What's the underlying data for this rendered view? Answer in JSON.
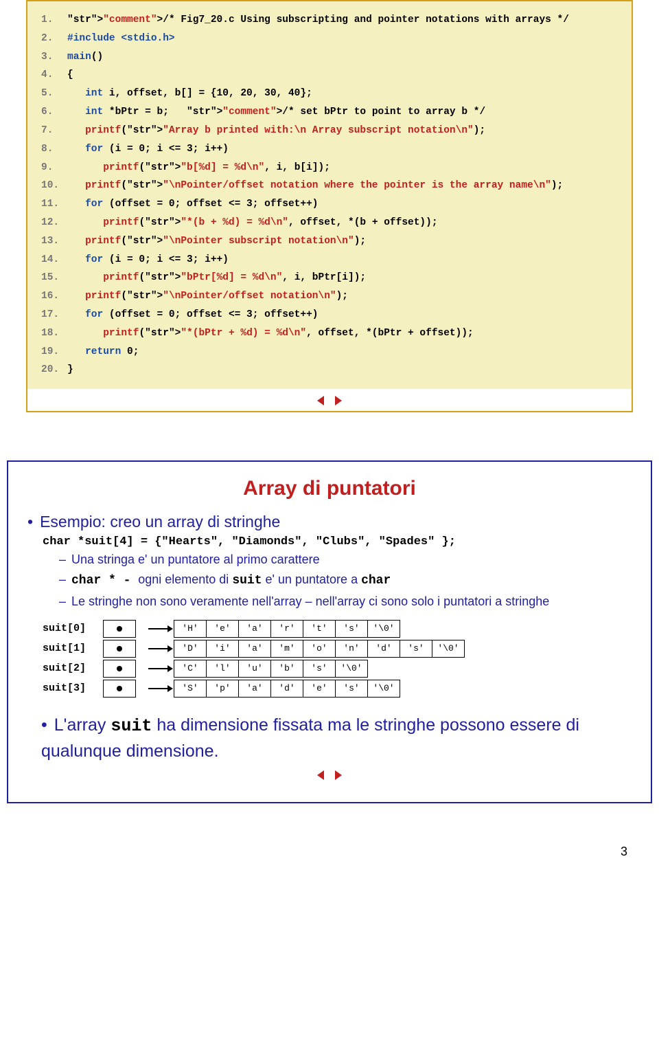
{
  "slide1": {
    "lines": [
      {
        "n": "1.",
        "a": "/* Fig7_20.c Using subscripting and pointer notations with arrays */"
      },
      {
        "n": "2.",
        "a": "#include <stdio.h>"
      },
      {
        "n": "3.",
        "a": "main()"
      },
      {
        "n": "4.",
        "a": "{"
      },
      {
        "n": "5.",
        "a": "   int i, offset, b[] = {10, 20, 30, 40};"
      },
      {
        "n": "6.",
        "a": "   int *bPtr = b;   /* set bPtr to point to array b */"
      },
      {
        "n": "7.",
        "a": "   printf(\"Array b printed with:\\n Array subscript notation\\n\");"
      },
      {
        "n": "8.",
        "a": "   for (i = 0; i <= 3; i++)"
      },
      {
        "n": "9.",
        "a": "      printf(\"b[%d] = %d\\n\", i, b[i]);"
      },
      {
        "n": "10.",
        "a": "   printf(\"\\nPointer/offset notation where the pointer is the array name\\n\");"
      },
      {
        "n": "11.",
        "a": "   for (offset = 0; offset <= 3; offset++)"
      },
      {
        "n": "12.",
        "a": "      printf(\"*(b + %d) = %d\\n\", offset, *(b + offset));"
      },
      {
        "n": "13.",
        "a": "   printf(\"\\nPointer subscript notation\\n\");"
      },
      {
        "n": "14.",
        "a": "   for (i = 0; i <= 3; i++)"
      },
      {
        "n": "15.",
        "a": "      printf(\"bPtr[%d] = %d\\n\", i, bPtr[i]);"
      },
      {
        "n": "16.",
        "a": "   printf(\"\\nPointer/offset notation\\n\");"
      },
      {
        "n": "17.",
        "a": "   for (offset = 0; offset <= 3; offset++)"
      },
      {
        "n": "18.",
        "a": "      printf(\"*(bPtr + %d) = %d\\n\", offset, *(bPtr + offset));"
      },
      {
        "n": "19.",
        "a": "   return 0;"
      },
      {
        "n": "20.",
        "a": "}"
      }
    ]
  },
  "slide2": {
    "title": "Array di puntatori",
    "b1": "Esempio: creo un array di stringhe",
    "code": "char *suit[4] = {\"Hearts\", \"Diamonds\", \"Clubs\", \"Spades\" };",
    "s1": "Una stringa e' un puntatore al primo carattere",
    "s2a": "char * - ",
    "s2b": "ogni elemento di ",
    "s2c": "suit",
    "s2d": " e' un puntatore a ",
    "s2e": "char",
    "s3": "Le stringhe non sono veramente nell'array – nell'array ci sono solo i puntatori a stringhe",
    "rows": [
      {
        "lbl": "suit[0]",
        "cells": [
          "'H'",
          "'e'",
          "'a'",
          "'r'",
          "'t'",
          "'s'",
          "'\\0'"
        ]
      },
      {
        "lbl": "suit[1]",
        "cells": [
          "'D'",
          "'i'",
          "'a'",
          "'m'",
          "'o'",
          "'n'",
          "'d'",
          "'s'",
          "'\\0'"
        ]
      },
      {
        "lbl": "suit[2]",
        "cells": [
          "'C'",
          "'l'",
          "'u'",
          "'b'",
          "'s'",
          "'\\0'"
        ]
      },
      {
        "lbl": "suit[3]",
        "cells": [
          "'S'",
          "'p'",
          "'a'",
          "'d'",
          "'e'",
          "'s'",
          "'\\0'"
        ]
      }
    ],
    "big1": "L'array ",
    "big2": "suit",
    "big3": " ha  dimensione fissata ma le stringhe possono essere di qualunque dimensione."
  },
  "pagenum": "3"
}
